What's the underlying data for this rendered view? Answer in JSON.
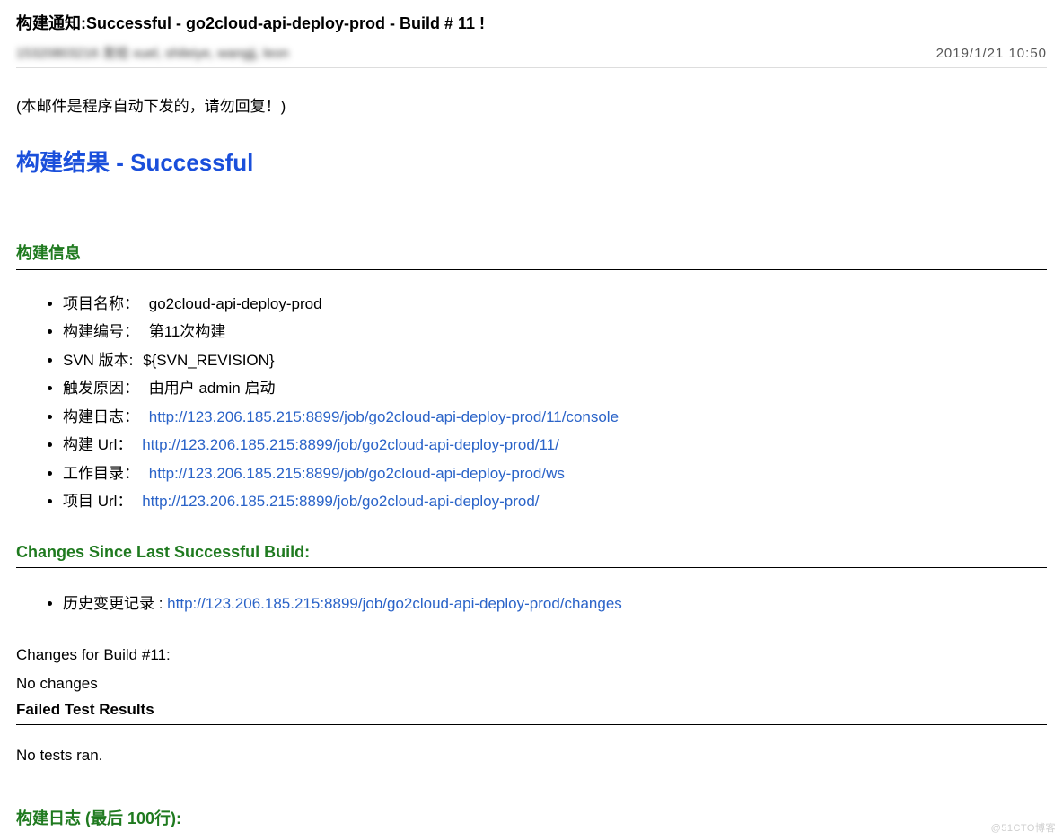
{
  "email": {
    "subject": "构建通知:Successful - go2cloud-api-deploy-prod - Build # 11 !",
    "from_line": "15320803216 发给 xuel, shileiye, wangjj, leon",
    "date": "2019/1/21   10:50"
  },
  "auto_notice": "(本邮件是程序自动下发的，请勿回复！)",
  "build_result": "构建结果 - Successful",
  "sections": {
    "build_info_title": "构建信息",
    "changes_title": "Changes Since Last Successful Build:",
    "build_log_title": "构建日志 (最后 100行):"
  },
  "build_info": {
    "project_name_label": "项目名称：",
    "project_name_value": "go2cloud-api-deploy-prod",
    "build_number_label": "构建编号：",
    "build_number_value": "第11次构建",
    "svn_label": "SVN 版本:",
    "svn_value": "${SVN_REVISION}",
    "trigger_label": "触发原因：",
    "trigger_value": "由用户 admin 启动",
    "build_log_label": "构建日志：",
    "build_log_url": "http://123.206.185.215:8899/job/go2cloud-api-deploy-prod/11/console",
    "build_url_label": "构建  Url：",
    "build_url_value": "http://123.206.185.215:8899/job/go2cloud-api-deploy-prod/11/",
    "workdir_label": "工作目录：",
    "workdir_url": "http://123.206.185.215:8899/job/go2cloud-api-deploy-prod/ws",
    "project_url_label": "项目  Url：",
    "project_url_value": "http://123.206.185.215:8899/job/go2cloud-api-deploy-prod/"
  },
  "changes": {
    "history_label": "历史变更记录 : ",
    "history_url": "http://123.206.185.215:8899/job/go2cloud-api-deploy-prod/changes",
    "changes_for": "Changes for Build #11:",
    "no_changes": "No changes",
    "failed_tests": "Failed Test Results",
    "no_tests": "No tests ran."
  },
  "watermark": "@51CTO博客"
}
